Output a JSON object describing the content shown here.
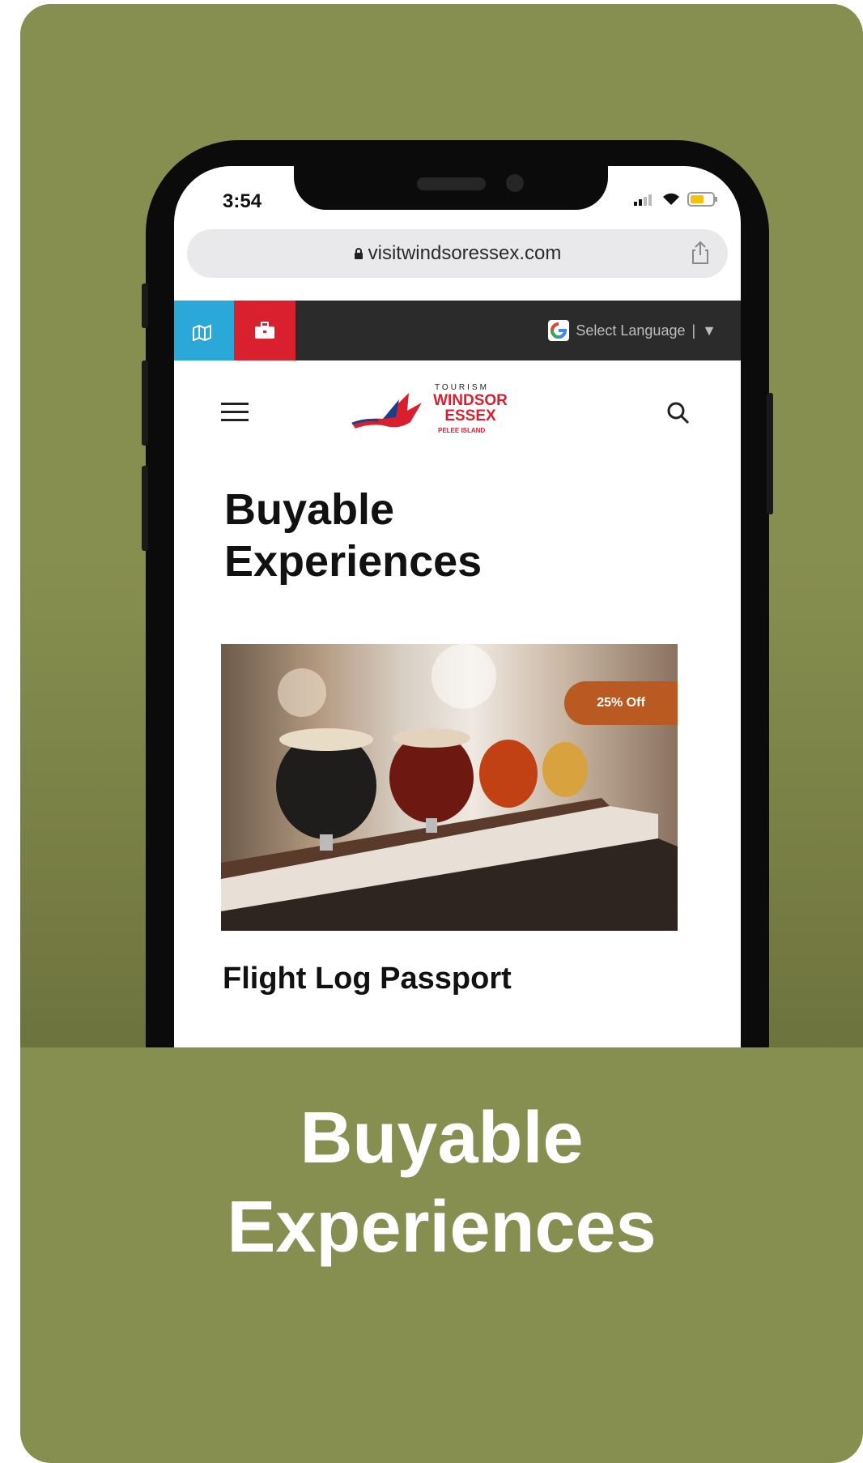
{
  "phone": {
    "status": {
      "time": "3:54"
    },
    "browser": {
      "url": "visitwindsoressex.com"
    },
    "topbar": {
      "language_label": "Select Language",
      "language_arrow": "▼"
    },
    "logo": {
      "small": "TOURISM",
      "big_line1": "WINDSOR",
      "big_line2": "ESSEX",
      "tiny": "PELEE ISLAND"
    },
    "page": {
      "title_line1": "Buyable",
      "title_line2": "Experiences",
      "discount_badge": "25% Off",
      "item_title": "Flight Log Passport"
    }
  },
  "caption": {
    "line1": "Buyable",
    "line2": "Experiences"
  },
  "colors": {
    "background": "#878f50",
    "topbar_blue": "#2aa9d8",
    "topbar_red": "#d8202e",
    "badge": "#b85a22"
  }
}
